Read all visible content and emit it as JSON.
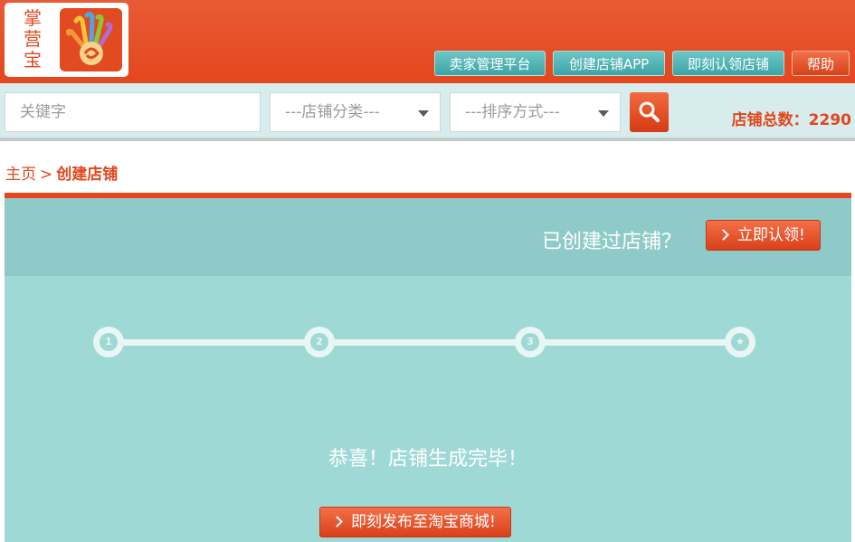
{
  "header": {
    "logo_text": "掌营宝",
    "nav": [
      {
        "label": "卖家管理平台"
      },
      {
        "label": "创建店铺APP"
      },
      {
        "label": "即刻认领店铺"
      },
      {
        "label": "帮助"
      }
    ]
  },
  "search": {
    "keyword_placeholder": "关键字",
    "category_select": "---店铺分类---",
    "sort_select": "---排序方式---",
    "store_total": "店铺总数：2290"
  },
  "breadcrumb": {
    "home": "主页",
    "separator": ">",
    "current": "创建店铺"
  },
  "panel": {
    "question": "已创建过店铺？",
    "claim_button": "立即认领!",
    "steps": [
      "1",
      "2",
      "3",
      "★"
    ],
    "congrats": "恭喜！店铺生成完毕！",
    "publish_button": "即刻发布至淘宝商城!"
  },
  "colors": {
    "brand_red": "#e4471d",
    "teal_button": "#4aacac",
    "panel_bg": "#9fd9d6"
  }
}
